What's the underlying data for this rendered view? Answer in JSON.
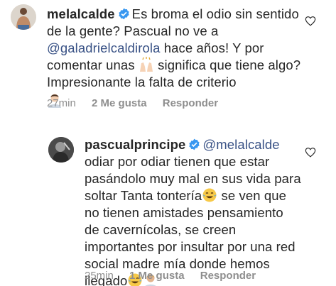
{
  "comments": [
    {
      "username": "melalcalde",
      "text_1": "Es broma el odio sin sentido de la gente? Pascual no ve a ",
      "mention": "@galadrielcaldirola",
      "text_2": " hace años! Y por comentar unas ",
      "text_3": " significa que tiene algo? Impresionante la falta de criterio",
      "time": "27min",
      "likes": "2 Me gusta",
      "reply": "Responder"
    },
    {
      "username": "pascualprincipe",
      "mention": "@melalcalde",
      "text_1": " odiar por odiar tienen que estar pasándolo muy mal en sus vida para soltar Tanta tontería",
      "text_2": " se ven que no tienen amistades pensamiento de cavernícolas, se creen importantes por insultar por una red social madre mía donde hemos llegado",
      "time": "25min",
      "likes": "1 Me gusta",
      "reply": "Responder"
    }
  ],
  "colors": {
    "text": "#262626",
    "muted": "#8e8e8e",
    "mention": "#385185",
    "verified": "#3897f0"
  },
  "icons": {
    "verified": "verified-badge-icon",
    "like": "heart-outline-icon",
    "raised_hands": "raised-hands-emoji",
    "man": "man-emoji",
    "laughing": "tears-of-joy-emoji"
  }
}
